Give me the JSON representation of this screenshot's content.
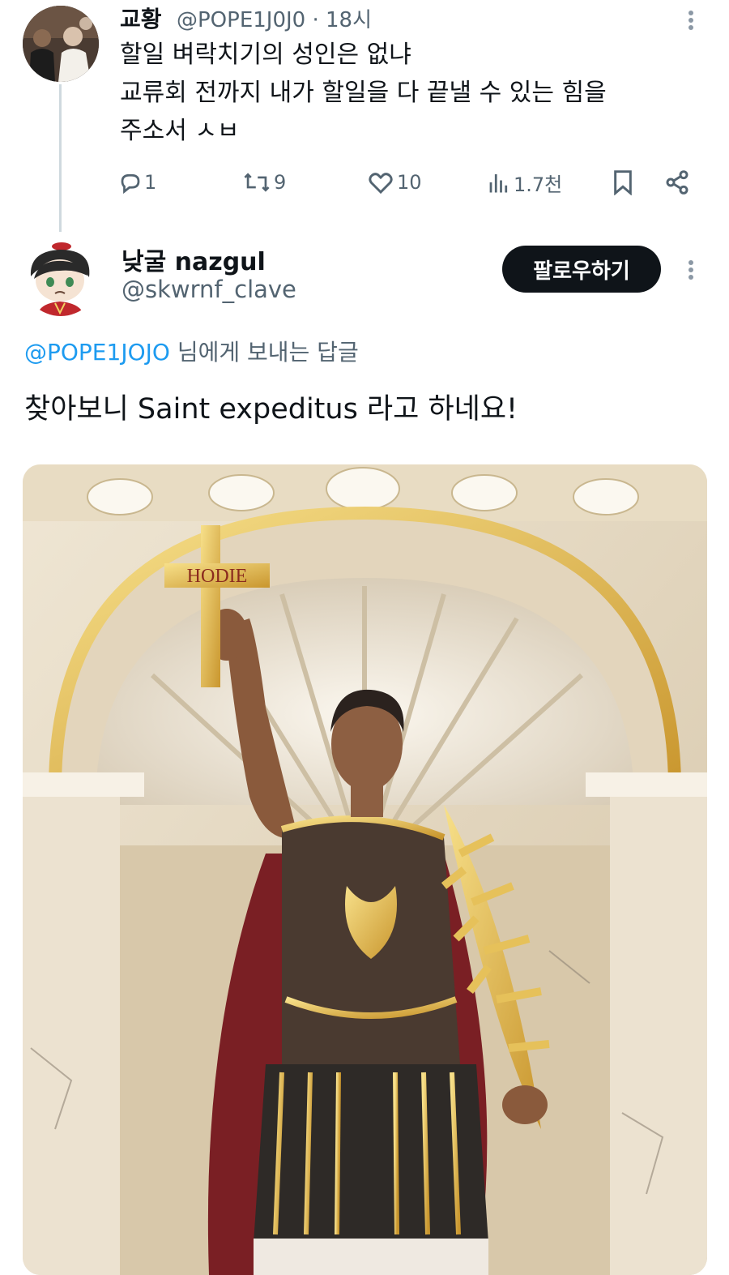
{
  "tweet1": {
    "display_name": "교황",
    "handle": "@POPE1J0J0",
    "separator": "·",
    "time": "18시",
    "lines": [
      "할일 벼락치기의 성인은 없냐",
      "교류회 전까지 내가 할일을 다 끝낼 수 있는 힘을",
      "주소서 ㅅㅂ"
    ],
    "replies": "1",
    "retweets": "9",
    "likes": "10",
    "views": "1.7천"
  },
  "tweet2": {
    "display_name": "낮굴 nazgul",
    "handle": "@skwrnf_clave",
    "follow_label": "팔로우하기",
    "reply_mention": "@POPE1JOJO",
    "reply_suffix": " 님에게 보내는 답글",
    "text": "찾아보니 Saint expeditus  라고 하네요!",
    "image_cross_text": "HODIE"
  },
  "colors": {
    "text": "#0f1419",
    "muted": "#536471",
    "link": "#1d9bf0",
    "line": "#cfd9de"
  }
}
